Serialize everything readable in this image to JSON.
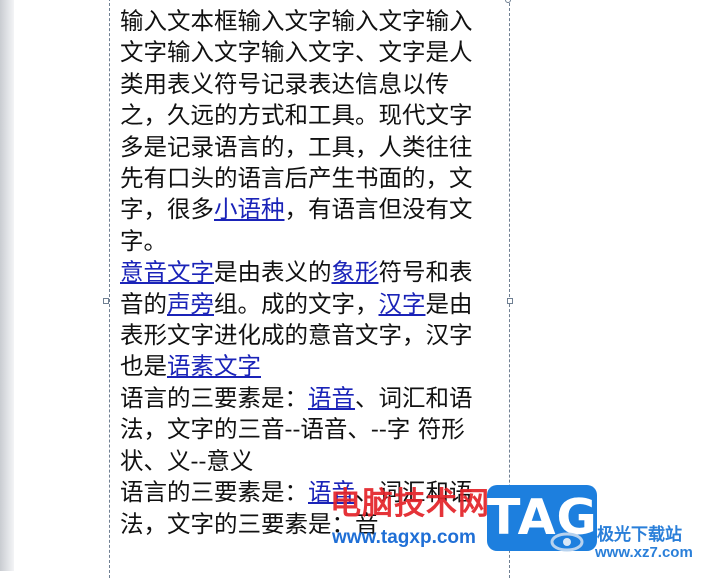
{
  "document": {
    "paragraphs": [
      [
        {
          "text": "输入文本框输入文字输入文字输入文字输入文字输入文字、文字是人类用表义符号记录表达信息以传之，久远的方式和工具。现代文字多是记录语言的，工具，人类往往先有口头的语言后产生书面的，文字，很多"
        },
        {
          "text": "小语种",
          "link": true
        },
        {
          "text": "，有语言但没有文字。"
        }
      ],
      [
        {
          "text": "意音文字",
          "link": true
        },
        {
          "text": "是由表义的"
        },
        {
          "text": "象形",
          "link": true
        },
        {
          "text": "符号和表音的"
        },
        {
          "text": "声旁",
          "link": true
        },
        {
          "text": "组。成的文字，"
        },
        {
          "text": "汉字",
          "link": true
        },
        {
          "text": "是由表形文字进化成的意音文字，汉字也是"
        },
        {
          "text": "语素文字",
          "link": true
        }
      ],
      [
        {
          "text": "语言的三要素是："
        },
        {
          "text": "语音",
          "link": true
        },
        {
          "text": "、词汇和语法，文字的三音--语音、--字 符形状、义--意义"
        }
      ],
      [
        {
          "text": "语言的三要素是："
        },
        {
          "text": "语音",
          "link": true
        },
        {
          "text": "、词汇和语法，文字的三要素是：音"
        }
      ]
    ]
  },
  "watermark": {
    "brand": "电脑技术网",
    "url": "www.tagxp.com",
    "tag": "TAG",
    "site_name": "极光下载站",
    "site_url": "www.xz7.com"
  },
  "colors": {
    "link": "#1a23b8",
    "text": "#111111",
    "frame": "#6f7f92",
    "watermark_red": "#e4242a",
    "watermark_blue": "#1d7fde"
  }
}
